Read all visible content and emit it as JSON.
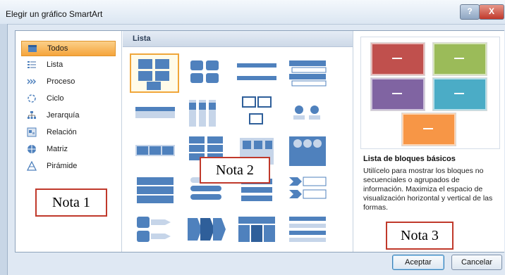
{
  "window": {
    "title": "Elegir un gráfico SmartArt",
    "help_label": "?",
    "close_label": "X"
  },
  "categories": [
    {
      "label": "Todos",
      "icon": "all-icon",
      "selected": true
    },
    {
      "label": "Lista",
      "icon": "list-icon",
      "selected": false
    },
    {
      "label": "Proceso",
      "icon": "process-icon",
      "selected": false
    },
    {
      "label": "Ciclo",
      "icon": "cycle-icon",
      "selected": false
    },
    {
      "label": "Jerarquía",
      "icon": "hierarchy-icon",
      "selected": false
    },
    {
      "label": "Relación",
      "icon": "relationship-icon",
      "selected": false
    },
    {
      "label": "Matriz",
      "icon": "matrix-icon",
      "selected": false
    },
    {
      "label": "Pirámide",
      "icon": "pyramid-icon",
      "selected": false
    }
  ],
  "gallery": {
    "header": "Lista"
  },
  "preview": {
    "colors": [
      "#c0504d",
      "#9bbb59",
      "#8064a2",
      "#4bacc6",
      "#f79646"
    ],
    "title": "Lista de bloques básicos",
    "description": "Utilícelo para mostrar los bloques no secuenciales o agrupados de información. Maximiza el espacio de visualización horizontal y vertical de las formas."
  },
  "notes": {
    "note1": "Nota 1",
    "note2": "Nota 2",
    "note3": "Nota 3"
  },
  "buttons": {
    "ok": "Aceptar",
    "cancel": "Cancelar"
  },
  "colors": {
    "accent_tile": "#4f81bd",
    "accent_dark": "#2f5f9a",
    "selection": "#f5a43b"
  }
}
